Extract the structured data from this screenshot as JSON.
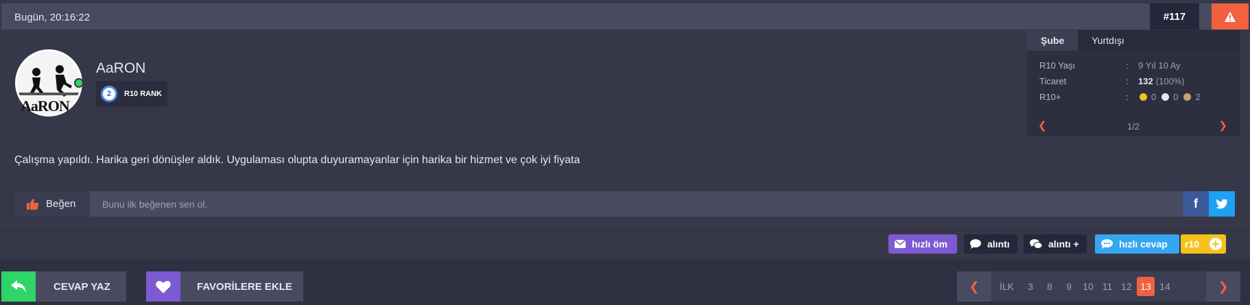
{
  "post": {
    "time": "Bugün, 20:16:22",
    "number": "#117",
    "report_icon": "warning-icon",
    "accent_color": "#f2613f"
  },
  "author": {
    "username": "AaRON",
    "avatar_text": "AaRON",
    "online": true,
    "rank_level": "2",
    "rank_label": "R10 RANK"
  },
  "side_panel": {
    "tabs": [
      {
        "label": "Şube",
        "active": true
      },
      {
        "label": "Yurtdışı",
        "active": false
      }
    ],
    "stats": [
      {
        "label": "R10 Yaşı",
        "value": "9 Yıl 10 Ay"
      },
      {
        "label": "Ticaret",
        "value_bold": "132",
        "value": "(100%)"
      },
      {
        "label": "R10+",
        "coins": [
          {
            "color": "#f5c21b",
            "count": "0"
          },
          {
            "color": "#e6e7ee",
            "count": "0"
          },
          {
            "color": "#c9a36a",
            "count": "2"
          }
        ]
      }
    ],
    "colon": ":",
    "page": "1/2"
  },
  "body": {
    "text": "Çalışma yapıldı. Harika geri dönüşler aldık. Uygulaması olupta duyuramayanlar için harika bir hizmet ve çok iyi fiyata"
  },
  "like_bar": {
    "like_label": "Beğen",
    "like_text": "Bunu ilk beğenen sen ol.",
    "facebook_label": "f"
  },
  "actions": {
    "quick_pm": "hızlı öm",
    "quote": "alıntı",
    "quote_plus": "alıntı +",
    "quick_reply": "hızlı cevap",
    "r10": "r10"
  },
  "bottom": {
    "reply_label": "CEVAP YAZ",
    "favorite_label": "FAVORİLERE EKLE"
  },
  "pagination": {
    "first": "İLK",
    "pages": [
      "3",
      "8",
      "9",
      "10",
      "11",
      "12",
      "13",
      "14"
    ],
    "current": "13"
  }
}
